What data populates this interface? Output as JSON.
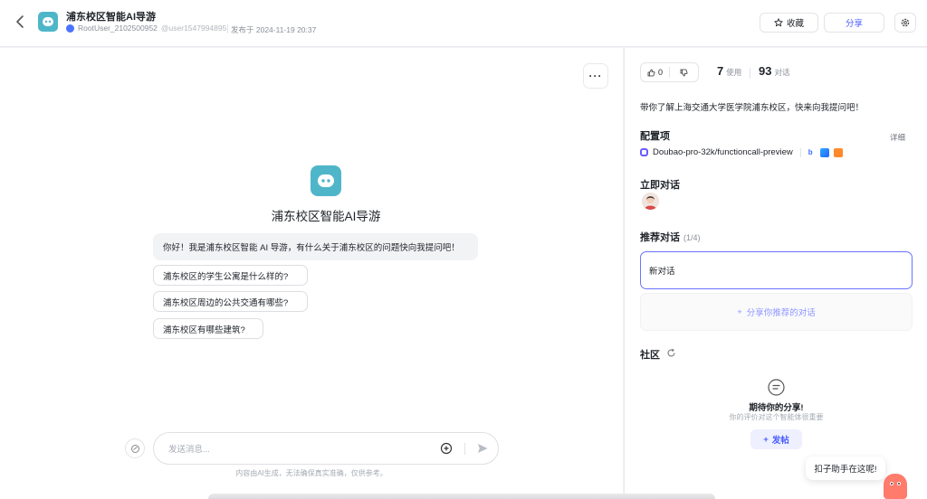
{
  "header": {
    "title": "浦东校区智能AI导游",
    "author": "RootUser_2102500952",
    "handle": "@user1547994895",
    "publish": "发布于 2024-11-19 20:37",
    "fav_label": "收藏",
    "share_label": "分享"
  },
  "chat": {
    "bot_name": "浦东校区智能AI导游",
    "greeting": "你好！我是浦东校区智能 AI 导游，有什么关于浦东校区的问题快向我提问吧！",
    "suggestions": [
      "浦东校区的学生公寓是什么样的?",
      "浦东校区周边的公共交通有哪些?",
      "浦东校区有哪些建筑?"
    ],
    "input_placeholder": "发送消息...",
    "disclaimer": "内容由AI生成，无法确保真实准确，仅供参考。"
  },
  "side": {
    "likes": "0",
    "uses": "7",
    "uses_label": "使用",
    "chats": "93",
    "chats_label": "对话",
    "description": "带你了解上海交通大学医学院浦东校区，快来向我提问吧！",
    "config_title": "配置项",
    "detail_label": "详细",
    "model": "Doubao-pro-32k/functioncall-preview",
    "start_title": "立即对话",
    "rec_title": "推荐对话",
    "rec_count": "(1/4)",
    "new_chat": "新对话",
    "share_rec": "分享你推荐的对话",
    "community_title": "社区",
    "empty_title": "期待你的分享!",
    "empty_sub": "你的评价对这个智能体很重要",
    "post_label": "发帖"
  },
  "assistant": {
    "bubble": "扣子助手在这呢!"
  },
  "colors": {
    "accent": "#4a5cff",
    "bot_icon": "#4fb6c9"
  }
}
